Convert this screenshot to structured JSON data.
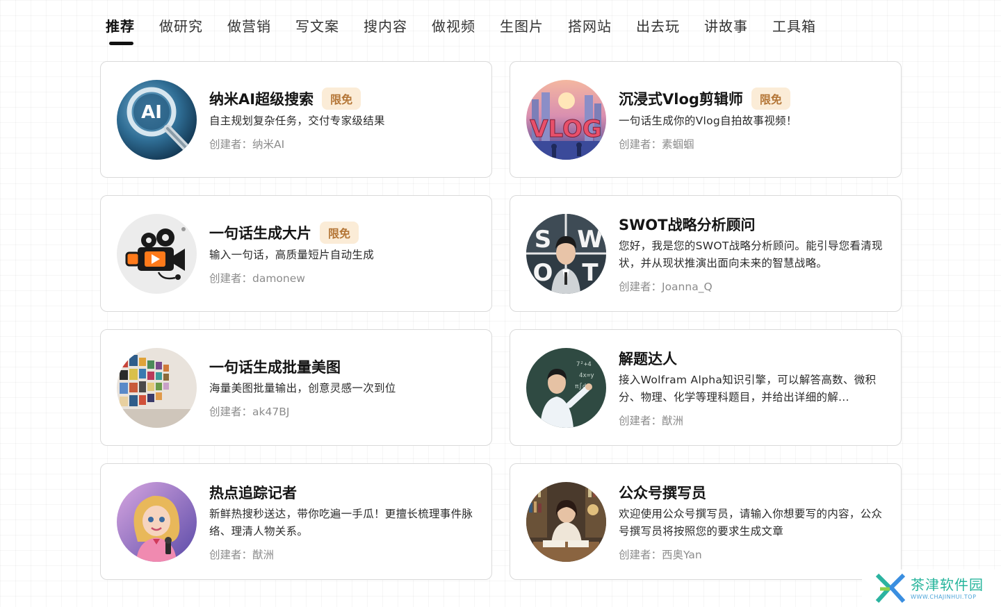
{
  "tabs": [
    "推荐",
    "做研究",
    "做营销",
    "写文案",
    "搜内容",
    "做视频",
    "生图片",
    "搭网站",
    "出去玩",
    "讲故事",
    "工具箱"
  ],
  "active_tab": "推荐",
  "creator_prefix": "创建者：",
  "cards": [
    {
      "title": "纳米AI超级搜索",
      "badge": "限免",
      "desc": "自主规划复杂任务，交付专家级结果",
      "creator": "创建者：纳米AI",
      "icon": "ai-magnifier-icon"
    },
    {
      "title": "沉浸式Vlog剪辑师",
      "badge": "限免",
      "desc": "一句话生成你的Vlog自拍故事视频！",
      "creator": "创建者：素蝈蝈",
      "icon": "vlog-city-icon"
    },
    {
      "title": "一句话生成大片",
      "badge": "限免",
      "desc": "输入一句话，高质量短片自动生成",
      "creator": "创建者：damonew",
      "icon": "movie-camera-icon"
    },
    {
      "title": "SWOT战略分析顾问",
      "badge": "",
      "desc": "您好，我是您的SWOT战略分析顾问。能引导您看清现状，并从现状推演出面向未来的智慧战略。",
      "creator": "创建者：Joanna_Q",
      "icon": "swot-portrait-icon"
    },
    {
      "title": "一句话生成批量美图",
      "badge": "",
      "desc": "海量美图批量输出，创意灵感一次到位",
      "creator": "创建者：ak47BJ",
      "icon": "gallery-wall-icon"
    },
    {
      "title": "解题达人",
      "badge": "",
      "desc": "接入Wolfram Alpha知识引擎，可以解答高数、微积分、物理、化学等理科题目，并给出详细的解...",
      "creator": "创建者：猷洲",
      "icon": "teacher-blackboard-icon"
    },
    {
      "title": "热点追踪记者",
      "badge": "",
      "desc": "新鲜热搜秒送达，带你吃遍一手瓜！更擅长梳理事件脉络、理清人物关系。",
      "creator": "创建者：猷洲",
      "icon": "reporter-girl-icon"
    },
    {
      "title": "公众号撰写员",
      "badge": "",
      "desc": "欢迎使用公众号撰写员，请输入你想要写的内容，公众号撰写员将按照您的要求生成文章",
      "creator": "创建者：西奥Yan",
      "icon": "writer-desk-icon"
    }
  ],
  "watermark": {
    "cn": "茶津软件园",
    "en": "WWW.CHAJINHUI.TOP"
  }
}
